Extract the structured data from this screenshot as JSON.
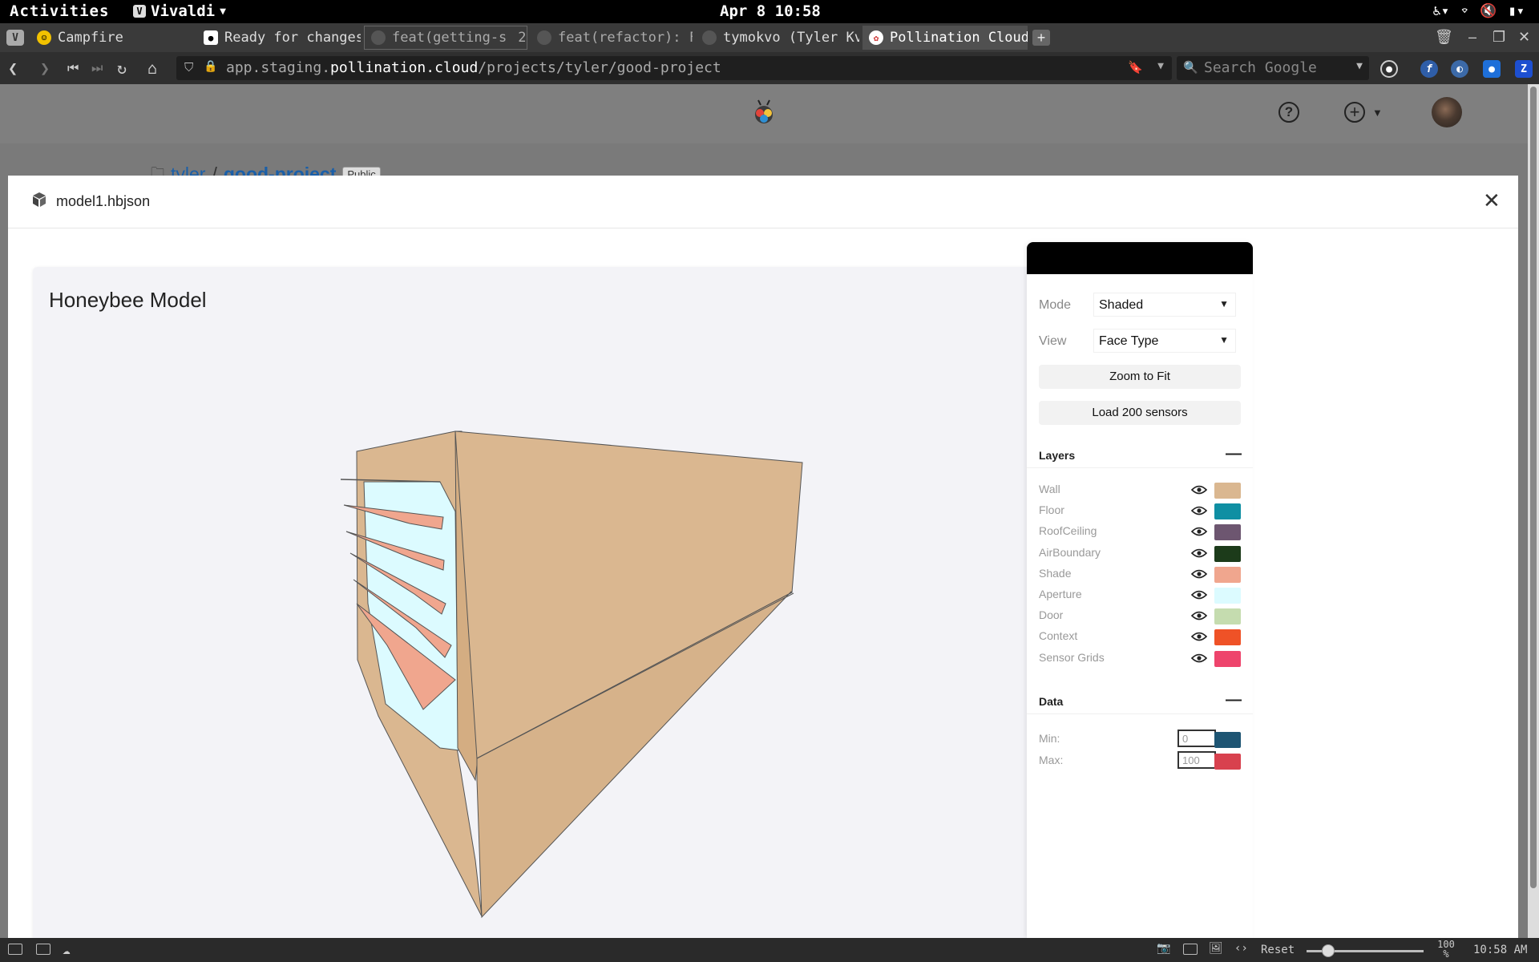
{
  "topbar": {
    "activities": "Activities",
    "app": "Vivaldi",
    "clock": "Apr 8 10:58"
  },
  "tabs": [
    {
      "label": "Campfire",
      "icon": "campfire-icon",
      "color": "#f2c200"
    },
    {
      "label": "Ready for changes",
      "icon": "loom-icon",
      "color": "#ffffff"
    },
    {
      "label": "feat(getting-s",
      "count": "2",
      "icon": "github-icon",
      "color": "#555555"
    },
    {
      "label": "feat(refactor): F",
      "icon": "github-icon",
      "color": "#555555"
    },
    {
      "label": "tymokvo (Tyler Kv",
      "icon": "github-icon",
      "color": "#555555"
    },
    {
      "label": "Pollination Cloud",
      "icon": "pollination-icon",
      "color": "#ffffff"
    }
  ],
  "address": {
    "url_prefix": "app.staging.",
    "url_host": "pollination.cloud",
    "url_path": "/projects/tyler/good-project",
    "search_placeholder": "Search Google"
  },
  "breadcrumb": {
    "owner": "tyler",
    "sep": "/",
    "project": "good-project",
    "visibility": "Public"
  },
  "modal": {
    "title": "model1.hbjson",
    "close": "X"
  },
  "viewer": {
    "title": "Honeybee Model"
  },
  "panel": {
    "mode_label": "Mode",
    "mode_value": "Shaded",
    "view_label": "View",
    "view_value": "Face Type",
    "zoom_button": "Zoom to Fit",
    "sensor_button": "Load 200 sensors",
    "layers_title": "Layers",
    "layers": [
      {
        "name": "Wall",
        "color": "#dab790"
      },
      {
        "name": "Floor",
        "color": "#0f8fa3"
      },
      {
        "name": "RoofCeiling",
        "color": "#6d5670"
      },
      {
        "name": "AirBoundary",
        "color": "#1c3b1a"
      },
      {
        "name": "Shade",
        "color": "#f0a68e"
      },
      {
        "name": "Aperture",
        "color": "#dcfbff"
      },
      {
        "name": "Door",
        "color": "#c5dcaf"
      },
      {
        "name": "Context",
        "color": "#ef5227"
      },
      {
        "name": "Sensor Grids",
        "color": "#ee446c"
      }
    ],
    "data_title": "Data",
    "min_label": "Min:",
    "min_value": "0",
    "min_color": "#1e5573",
    "max_label": "Max:",
    "max_value": "100",
    "max_color": "#d8414e"
  },
  "statusbar": {
    "reset": "Reset",
    "zoom": "100 %",
    "clock": "10:58 AM"
  },
  "colors": {
    "wall": "#dab790",
    "shade": "#f0a68e",
    "aperture": "#dcfbff"
  }
}
